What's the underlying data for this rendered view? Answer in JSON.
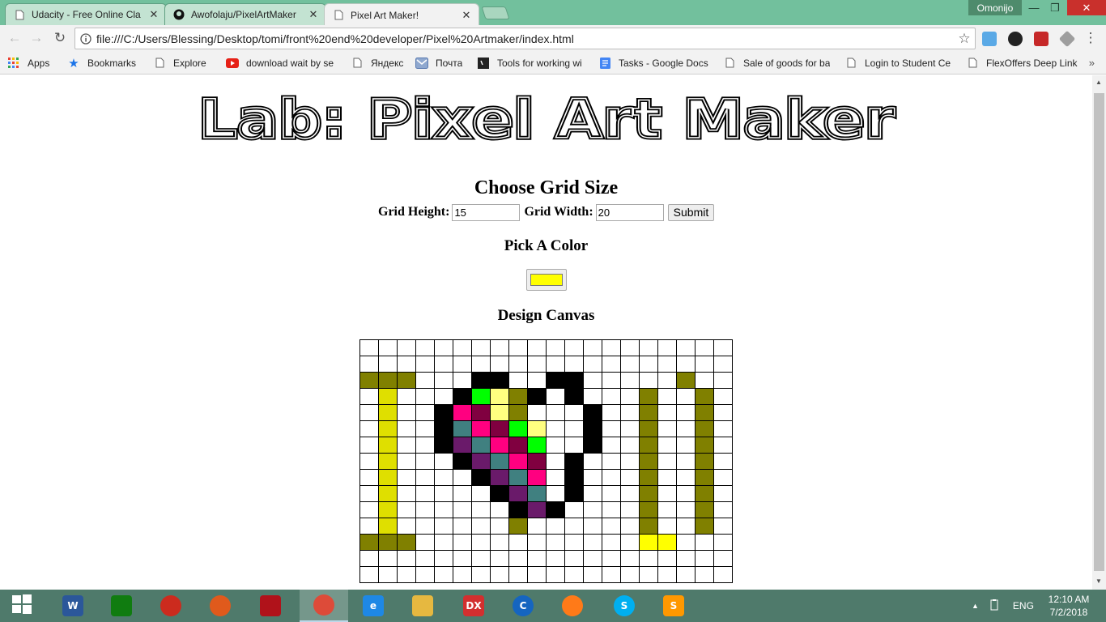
{
  "window": {
    "user": "Omonijo",
    "tabs": [
      {
        "label": "Udacity - Free Online Cla",
        "icon": "page-icon"
      },
      {
        "label": "Awofolaju/PixelArtMaker",
        "icon": "github-icon"
      },
      {
        "label": "Pixel Art Maker!",
        "icon": "page-icon"
      }
    ],
    "minimize": "—",
    "maximize": "❐",
    "close": "✕"
  },
  "toolbar": {
    "url": "file:///C:/Users/Blessing/Desktop/tomi/front%20end%20developer/Pixel%20Artmaker/index.html"
  },
  "bookmarks": [
    {
      "label": "Apps",
      "icon": "apps-icon"
    },
    {
      "label": "Bookmarks",
      "icon": "star-icon"
    },
    {
      "label": "Explore",
      "icon": "page-icon"
    },
    {
      "label": "download wait by se",
      "icon": "youtube-icon"
    },
    {
      "label": "Яндекс",
      "icon": "page-icon"
    },
    {
      "label": "Почта",
      "icon": "mail-icon"
    },
    {
      "label": "Tools for working wi",
      "icon": "terminal-icon"
    },
    {
      "label": "Tasks - Google Docs",
      "icon": "docs-icon"
    },
    {
      "label": "Sale of goods for ba",
      "icon": "page-icon"
    },
    {
      "label": "Login to Student Ce",
      "icon": "page-icon"
    },
    {
      "label": "FlexOffers Deep Link",
      "icon": "page-icon"
    }
  ],
  "page": {
    "heading": "Lab: Pixel Art Maker",
    "grid_title": "Choose Grid Size",
    "height_label": "Grid Height:",
    "height_value": "15",
    "width_label": "Grid Width:",
    "width_value": "20",
    "submit_label": "Submit",
    "color_title": "Pick A Color",
    "selected_color": "#ffff00",
    "canvas_title": "Design Canvas"
  },
  "canvas": {
    "palette": {
      ".": "#ffffff",
      "K": "#000000",
      "O": "#808000",
      "Y": "#dfdf00",
      "B": "#ffff00",
      "P": "#ff0080",
      "M": "#800040",
      "G": "#00ff00",
      "L": "#ffff80",
      "T": "#408080",
      "V": "#6a1a6a"
    },
    "rows": [
      "....................",
      "....................",
      "OOO...KK..KK.....O..",
      ".Y...KGLOK.K...O..O.",
      ".Y..KPMLO...K..O..O.",
      ".Y..KTPMGL..K..O..O.",
      ".Y..KVTPMG..K..O..O.",
      ".Y...KVTPM.K...O..O.",
      ".Y....KVTP.K...O..O.",
      ".Y.....KVT.K...O..O.",
      ".Y......KVK....O..O.",
      ".Y......O......O..O.",
      "OOO............BB...",
      "....................",
      "...................."
    ]
  },
  "taskbar": {
    "language": "ENG",
    "time": "12:10 AM",
    "date": "7/2/2018",
    "apps": [
      {
        "name": "start-icon",
        "label": "",
        "color": ""
      },
      {
        "name": "word-icon",
        "label": "W",
        "color": "#2b579a"
      },
      {
        "name": "store-icon",
        "label": "",
        "color": "#107c10"
      },
      {
        "name": "opera-icon",
        "label": "",
        "color": "#cc2b1e"
      },
      {
        "name": "media-player-icon",
        "label": "",
        "color": "#e05a1c"
      },
      {
        "name": "acrobat-icon",
        "label": "",
        "color": "#b0121a"
      },
      {
        "name": "chrome-icon",
        "label": "",
        "color": "#dd4b39"
      },
      {
        "name": "edge-icon",
        "label": "e",
        "color": "#1e88e5"
      },
      {
        "name": "file-explorer-icon",
        "label": "",
        "color": "#e6b840"
      },
      {
        "name": "dx-icon",
        "label": "DX",
        "color": "#d32f2f"
      },
      {
        "name": "ccleaner-icon",
        "label": "C",
        "color": "#1565c0"
      },
      {
        "name": "firefox-icon",
        "label": "",
        "color": "#ff7a18"
      },
      {
        "name": "skype-icon",
        "label": "S",
        "color": "#00aff0"
      },
      {
        "name": "sublime-icon",
        "label": "S",
        "color": "#ff9800"
      }
    ]
  }
}
